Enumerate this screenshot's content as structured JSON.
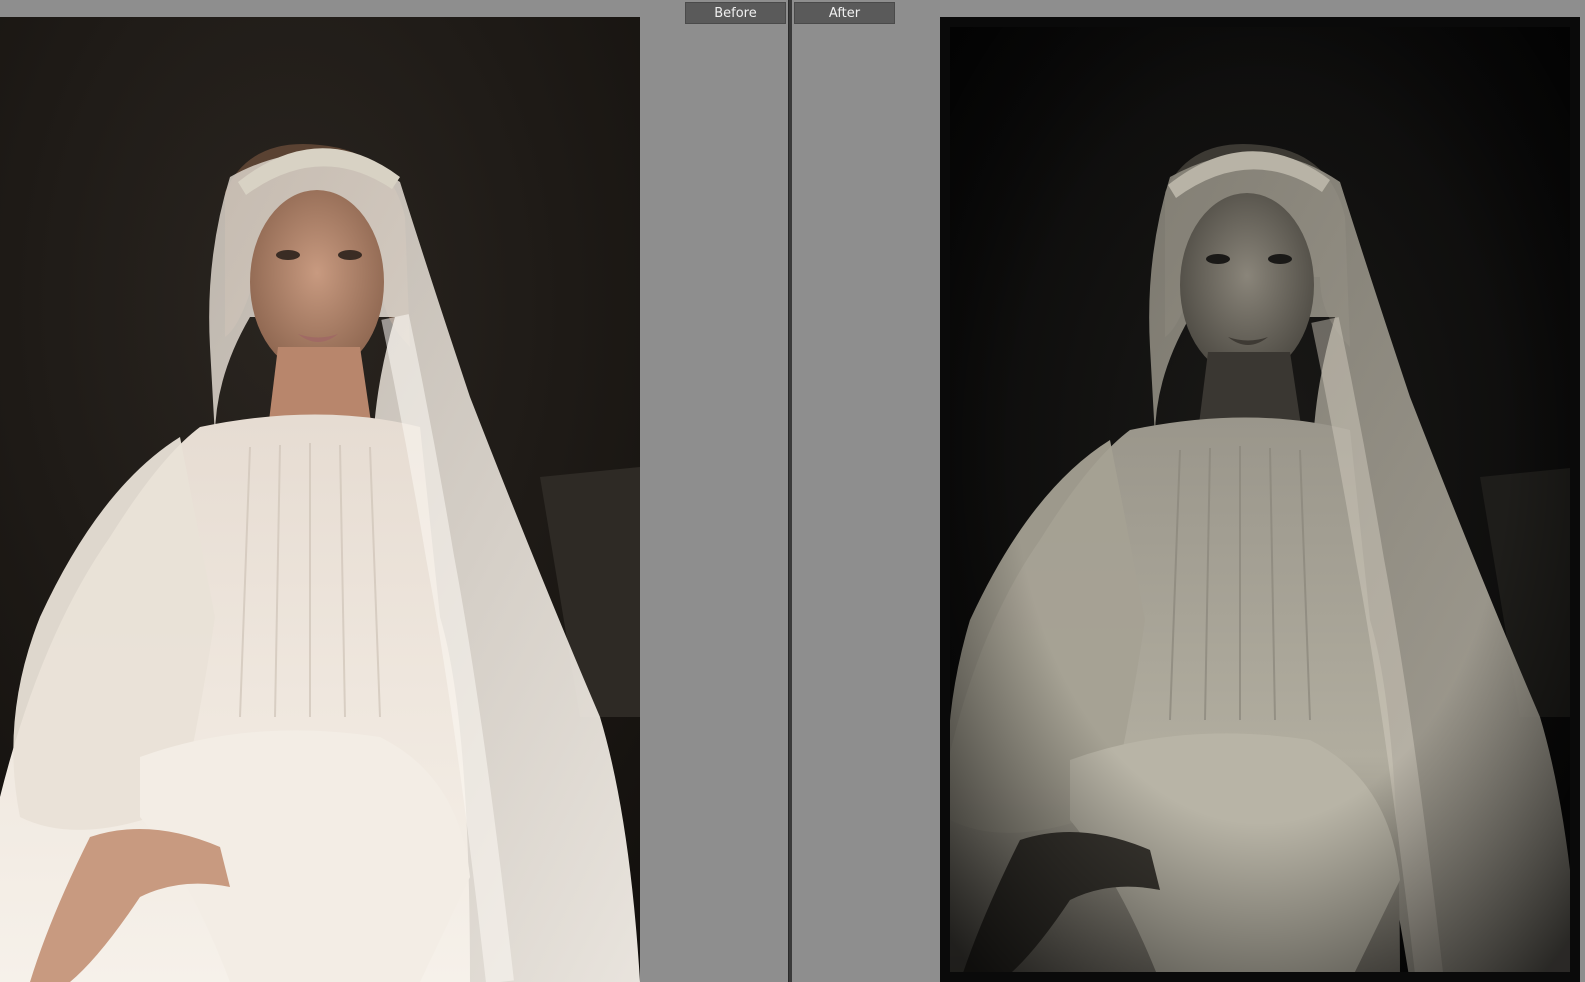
{
  "compare_view": {
    "before_label": "Before",
    "after_label": "After"
  },
  "colors": {
    "workspace_background": "#8e8e8e",
    "label_background": "#5a5a5a",
    "divider": "#3a3a3a"
  }
}
